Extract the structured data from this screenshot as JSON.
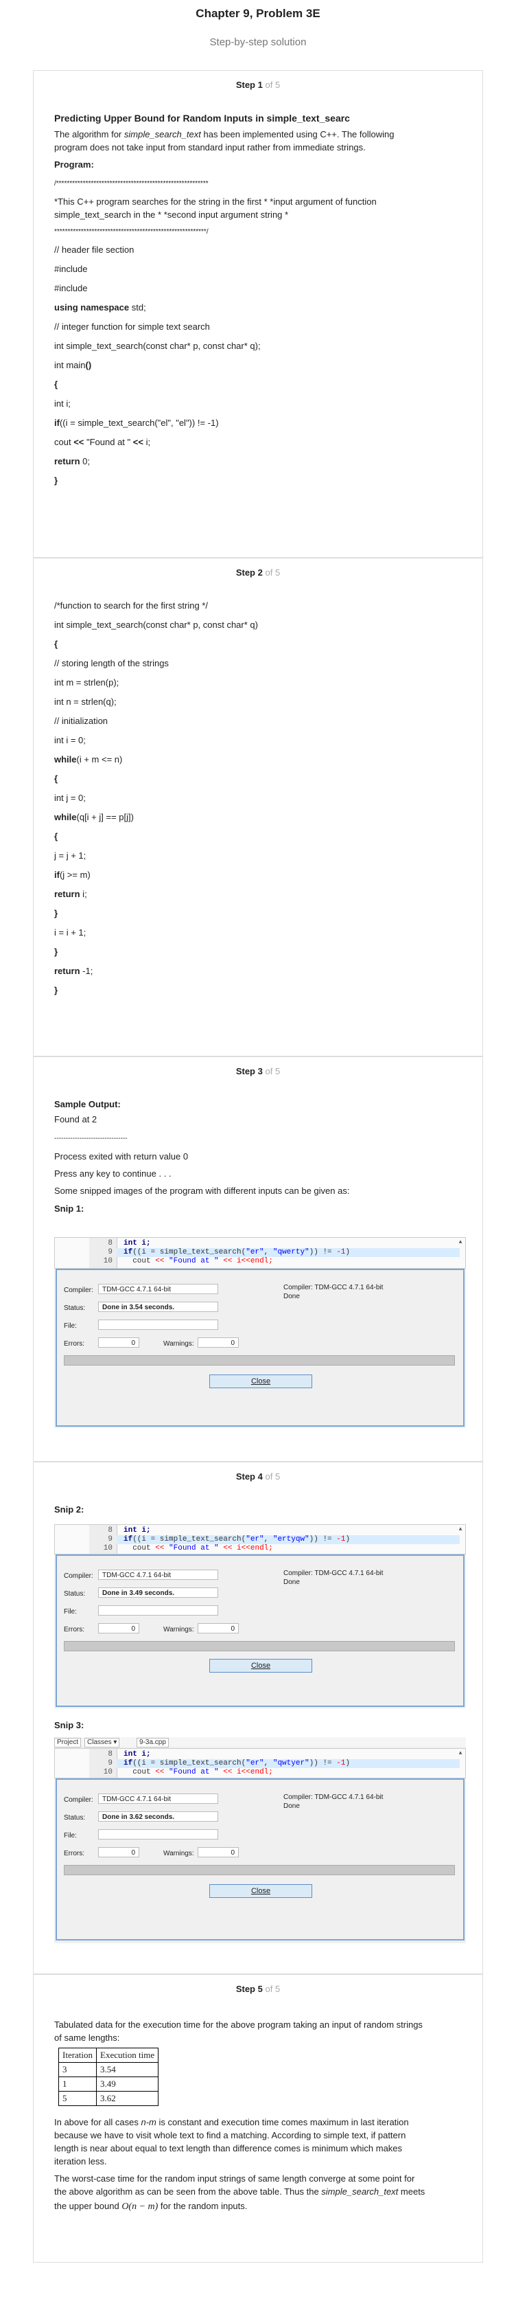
{
  "header": {
    "chapter": "Chapter 9, Problem 3E",
    "subtitle": "Step-by-step solution"
  },
  "steps": [
    {
      "label": "Step",
      "num": "1",
      "of": "of 5"
    },
    {
      "label": "Step",
      "num": "2",
      "of": "of 5"
    },
    {
      "label": "Step",
      "num": "3",
      "of": "of 5"
    },
    {
      "label": "Step",
      "num": "4",
      "of": "of 5"
    },
    {
      "label": "Step",
      "num": "5",
      "of": "of 5"
    }
  ],
  "step1": {
    "heading": "Predicting Upper Bound for Random Inputs in simple_text_searc",
    "intro_a": "The algorithm for ",
    "intro_em": "simple_search_text",
    "intro_b": " has been implemented using C++. The following",
    "intro_2": "program does not take input from standard input rather from immediate strings.",
    "program_label": "Program:",
    "lines": [
      "/*********************************************************",
      "*This C++ program searches for the string in the first * *input argument of function",
      "simple_text_search in the * *second input argument string *",
      "*********************************************************/",
      "// header file section",
      "#include",
      "#include",
      "std;",
      "// integer function for simple text search",
      "int simple_text_search(const char* p, const char* q);",
      "int main",
      "()",
      "{",
      "int i;",
      "if",
      "((i = simple_text_search(\"el\", \"el\")) != -1)",
      "cout ",
      "<<",
      " \"Found at \" ",
      " i;",
      "return",
      " 0;",
      "}",
      "using namespace"
    ]
  },
  "step2": {
    "lines": [
      "/*function to search for the first string */",
      "int simple_text_search(const char* p, const char* q)",
      "{",
      "// storing length of the strings",
      "int m = strlen(p);",
      "int n = strlen(q);",
      "// initialization",
      "int i = 0;",
      "while",
      "(i + m <= n)",
      "{",
      "int j = 0;",
      "while",
      "(q[i + j] == p[j])",
      "{",
      "j = j + 1;",
      "if",
      "(j >= m)",
      "return",
      " i;",
      "}",
      "i = i + 1;",
      "}",
      "return",
      " -1;",
      "}"
    ]
  },
  "step3": {
    "sample_label": "Sample Output:",
    "lines": [
      "Found at 2",
      "--------------------------------",
      "Process exited with return value 0",
      "Press any key to continue . . .",
      "Some snipped images of the program with different inputs can be given as:"
    ],
    "snip_label": "Snip 1:"
  },
  "snips": [
    {
      "code": {
        "l8": "int i;",
        "l9a": "if",
        "l9b": "((i = simple_text_search(",
        "l9s1": "\"er\"",
        "l9c": ", ",
        "l9s2": "\"qwerty\"",
        "l9d": ")) != ",
        "l9n": "-1",
        "l9e": ")",
        "l10a": "cout ",
        "l10b": "<< ",
        "l10s": "\"Found at \"",
        "l10c": " << i<<endl;"
      },
      "status": "Done in 3.54 seconds."
    },
    {
      "code": {
        "l8": "int i;",
        "l9a": "if",
        "l9b": "((i = simple_text_search(",
        "l9s1": "\"er\"",
        "l9c": ", ",
        "l9s2": "\"ertyqw\"",
        "l9d": ")) != ",
        "l9n": "-1",
        "l9e": ")",
        "l10a": "cout ",
        "l10b": "<< ",
        "l10s": "\"Found at \"",
        "l10c": " << i<<endl;"
      },
      "status": "Done in 3.49 seconds."
    },
    {
      "code": {
        "l8": "int i;",
        "l9a": "if",
        "l9b": "((i = simple_text_search(",
        "l9s1": "\"er\"",
        "l9c": ", ",
        "l9s2": "\"qwtyer\"",
        "l9d": ")) != ",
        "l9n": "-1",
        "l9e": ")",
        "l10a": "cout ",
        "l10b": "<< ",
        "l10s": "\"Found at \"",
        "l10c": " << i<<endl;"
      },
      "status": "Done in 3.62 seconds."
    }
  ],
  "dialog": {
    "compiler_label": "Compiler:",
    "compiler_value": "TDM-GCC 4.7.1 64-bit",
    "right_line1": "Compiler: TDM-GCC 4.7.1 64-bit",
    "right_line2": "Done",
    "status_label": "Status:",
    "file_label": "File:",
    "errors_label": "Errors:",
    "errors_value": "0",
    "warnings_label": "Warnings:",
    "warnings_value": "0",
    "close_label": "Close"
  },
  "line_numbers": [
    "8",
    "9",
    "10"
  ],
  "step4": {
    "snip2_label": "Snip 2:",
    "snip3_label": "Snip 3:",
    "tabs": {
      "project": "Project",
      "classes": "Classes",
      "file": "9-3a.cpp"
    }
  },
  "step5": {
    "intro_1": "Tabulated data for the execution time for the above program taking an input of random strings",
    "intro_2": "of same lengths:",
    "table": {
      "headers": [
        "Iteration",
        "Execution time"
      ],
      "rows": [
        [
          "3",
          "3.54"
        ],
        [
          "1",
          "3.49"
        ],
        [
          "5",
          "3.62"
        ]
      ]
    },
    "p1_a": "In above for all cases ",
    "p1_em": "n-m",
    "p1_b": " is constant and execution time comes maximum in last iteration",
    "p1_2": "because we have to visit whole text to find a matching. According to simple text, if pattern",
    "p1_3": "length is near about equal to text length than difference comes is minimum which makes",
    "p1_4": "iteration less.",
    "p2_1": "The worst-case time for the random input strings of same length converge at some point for",
    "p2_2a": "the above algorithm as can be seen from the above table. Thus the ",
    "p2_2em": "simple_search_text",
    "p2_2b": " meets",
    "p2_3a": "the upper bound ",
    "p2_3math": "O(n − m)",
    "p2_3b": " for the random inputs."
  }
}
